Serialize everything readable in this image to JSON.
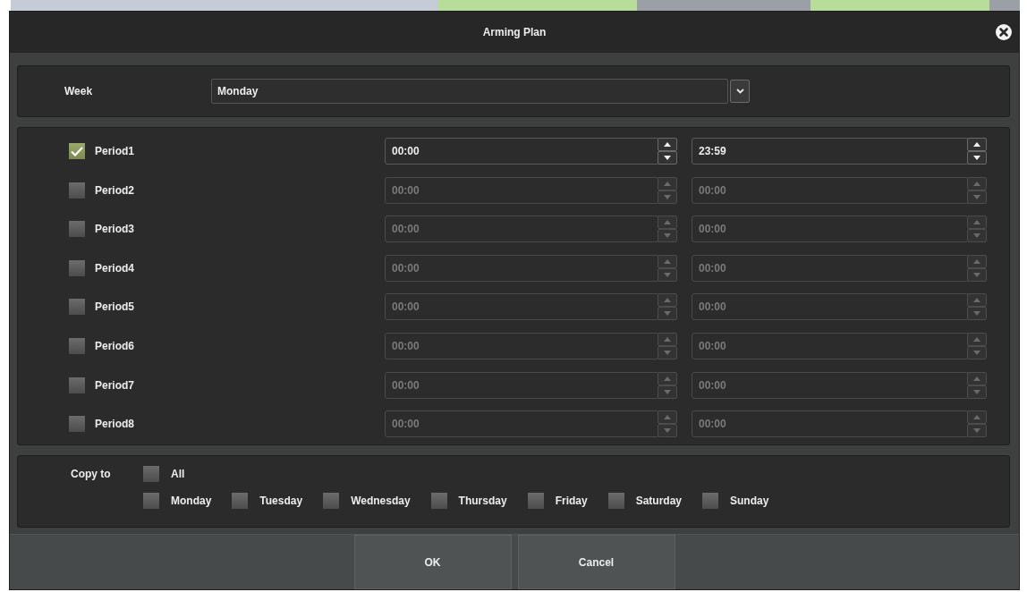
{
  "dialog": {
    "title": "Arming Plan"
  },
  "week": {
    "label": "Week",
    "value": "Monday"
  },
  "periods": [
    {
      "label": "Period1",
      "checked": true,
      "start": "00:00",
      "end": "23:59"
    },
    {
      "label": "Period2",
      "checked": false,
      "start": "00:00",
      "end": "00:00"
    },
    {
      "label": "Period3",
      "checked": false,
      "start": "00:00",
      "end": "00:00"
    },
    {
      "label": "Period4",
      "checked": false,
      "start": "00:00",
      "end": "00:00"
    },
    {
      "label": "Period5",
      "checked": false,
      "start": "00:00",
      "end": "00:00"
    },
    {
      "label": "Period6",
      "checked": false,
      "start": "00:00",
      "end": "00:00"
    },
    {
      "label": "Period7",
      "checked": false,
      "start": "00:00",
      "end": "00:00"
    },
    {
      "label": "Period8",
      "checked": false,
      "start": "00:00",
      "end": "00:00"
    }
  ],
  "copy_to": {
    "label": "Copy to",
    "all": {
      "label": "All",
      "checked": false
    },
    "days": [
      {
        "label": "Monday",
        "checked": false
      },
      {
        "label": "Tuesday",
        "checked": false
      },
      {
        "label": "Wednesday",
        "checked": false
      },
      {
        "label": "Thursday",
        "checked": false
      },
      {
        "label": "Friday",
        "checked": false
      },
      {
        "label": "Saturday",
        "checked": false
      },
      {
        "label": "Sunday",
        "checked": false
      }
    ]
  },
  "buttons": [
    "OK",
    "Cancel"
  ]
}
